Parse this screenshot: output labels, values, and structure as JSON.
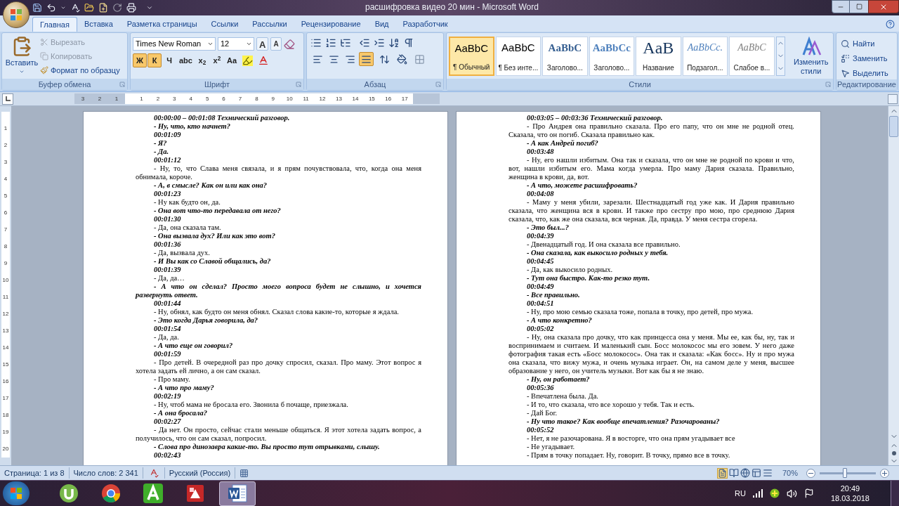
{
  "window": {
    "title": "расшифровка видео 20 мин - Microsoft Word"
  },
  "ribbon_tabs": [
    {
      "label": "Главная",
      "selected": true
    },
    {
      "label": "Вставка",
      "selected": false
    },
    {
      "label": "Разметка страницы",
      "selected": false
    },
    {
      "label": "Ссылки",
      "selected": false
    },
    {
      "label": "Рассылки",
      "selected": false
    },
    {
      "label": "Рецензирование",
      "selected": false
    },
    {
      "label": "Вид",
      "selected": false
    },
    {
      "label": "Разработчик",
      "selected": false
    }
  ],
  "clipboard": {
    "paste": "Вставить",
    "items": [
      {
        "kind": "cut",
        "label": "Вырезать",
        "disabled": true
      },
      {
        "kind": "copy",
        "label": "Копировать",
        "disabled": true
      },
      {
        "kind": "format",
        "label": "Формат по образцу",
        "disabled": false
      }
    ],
    "label": "Буфер обмена"
  },
  "font": {
    "name": "Times New Roman",
    "size": "12",
    "grow": "A",
    "shrink": "A",
    "formats": [
      {
        "label": "Ж",
        "selected": true
      },
      {
        "label": "К",
        "selected": true
      },
      {
        "label": "Ч",
        "selected": false
      },
      {
        "label": "abc",
        "selected": false
      },
      {
        "label": "x$_{2}$",
        "selected": false
      },
      {
        "label": "x$^{2}$",
        "selected": false
      },
      {
        "label": "Aa",
        "selected": false
      }
    ],
    "label": "Шрифт"
  },
  "paragraph": {
    "alignments": [
      {
        "kind": "left",
        "selected": false
      },
      {
        "kind": "center",
        "selected": false
      },
      {
        "kind": "right",
        "selected": false
      },
      {
        "kind": "justify",
        "selected": true
      }
    ],
    "label": "Абзац"
  },
  "styles": {
    "items": [
      {
        "kind": "normal",
        "sample": "AaBbC",
        "label": "¶ Обычный",
        "selected": true
      },
      {
        "kind": "normal",
        "sample": "AaBbC",
        "label": "¶ Без инте...",
        "selected": false
      },
      {
        "kind": "heading1",
        "sample": "AaBbC",
        "label": "Заголово...",
        "selected": false
      },
      {
        "kind": "heading2",
        "sample": "AaBbCc",
        "label": "Заголово...",
        "selected": false
      },
      {
        "kind": "title",
        "sample": "AaB",
        "label": "Название",
        "selected": false
      },
      {
        "kind": "subtitle",
        "sample": "AaBbCc.",
        "label": "Подзагол...",
        "selected": false
      },
      {
        "kind": "subtle",
        "sample": "AaBbC",
        "label": "Слабое в...",
        "selected": false
      }
    ],
    "change": "Изменить стили",
    "label": "Стили"
  },
  "editing": {
    "items": [
      {
        "kind": "find",
        "label": "Найти"
      },
      {
        "kind": "replace",
        "label": "Заменить"
      },
      {
        "kind": "select",
        "label": "Выделить"
      }
    ],
    "label": "Редактирование"
  },
  "ruler": {
    "left_labels": [
      "3",
      "2",
      "1"
    ],
    "right_labels": [
      "1",
      "2",
      "3",
      "4",
      "5",
      "6",
      "7",
      "8",
      "9",
      "10",
      "11",
      "12",
      "13",
      "14",
      "15",
      "16",
      "17"
    ]
  },
  "vertical_ruler": [
    "1",
    "2",
    "3",
    "4",
    "5",
    "6",
    "7",
    "8",
    "9",
    "10",
    "11",
    "12",
    "13",
    "14",
    "15",
    "16",
    "17",
    "18",
    "19",
    "20"
  ],
  "pages": [
    {
      "paragraphs": [
        {
          "kind": "time",
          "text": "00:00:00 – 00:01:08 Технический разговор."
        },
        {
          "kind": "question",
          "text": "- Ну, что, кто начнет?"
        },
        {
          "kind": "time",
          "text": "00:01:09"
        },
        {
          "kind": "question",
          "text": "- Я?"
        },
        {
          "kind": "question",
          "text": "- Да."
        },
        {
          "kind": "time",
          "text": "00:01:12"
        },
        {
          "kind": "speech",
          "text": "- Ну, то, что Слава меня связала, и я прям почувствовала, что, когда она меня обнимала, короче."
        },
        {
          "kind": "question",
          "text": "- А, в смысле? Как он или как она?"
        },
        {
          "kind": "time",
          "text": "00:01:23"
        },
        {
          "kind": "speech",
          "text": "- Ну как будто он, да."
        },
        {
          "kind": "question",
          "text": "- Она вот что-то передавала от него?"
        },
        {
          "kind": "time",
          "text": "00:01:30"
        },
        {
          "kind": "speech",
          "text": "- Да, она сказала там."
        },
        {
          "kind": "question",
          "text": "- Она вызвала дух? Или как это вот?"
        },
        {
          "kind": "time",
          "text": "00:01:36"
        },
        {
          "kind": "speech",
          "text": "- Да, вызвала дух."
        },
        {
          "kind": "question",
          "text": "- И Вы как со Славой общались, да?"
        },
        {
          "kind": "time",
          "text": "00:01:39"
        },
        {
          "kind": "speech",
          "text": "- Да, да…"
        },
        {
          "kind": "question",
          "text": "- А что он сделал? Просто моего вопроса будет не слышно, и хочется развернуть ответ."
        },
        {
          "kind": "time",
          "text": "00:01:44"
        },
        {
          "kind": "speech",
          "text": "- Ну, обнял, как будто он меня обнял. Сказал слова какие-то, которые я ждала."
        },
        {
          "kind": "question",
          "text": "- Это когда Дарья говорила, да?"
        },
        {
          "kind": "time",
          "text": "00:01:54"
        },
        {
          "kind": "speech",
          "text": "- Да, да."
        },
        {
          "kind": "question",
          "text": "- А что еще он говорил?"
        },
        {
          "kind": "time",
          "text": "00:01:59"
        },
        {
          "kind": "speech",
          "text": "- Про детей. В очередной раз про дочку спросил, сказал. Про маму. Этот вопрос я хотела задать ей лично, а он сам сказал."
        },
        {
          "kind": "speech",
          "text": "- Про маму."
        },
        {
          "kind": "question",
          "text": "- А что про маму?"
        },
        {
          "kind": "time",
          "text": "00:02:19"
        },
        {
          "kind": "speech",
          "text": "- Ну, чтоб мама не бросала его. Звонила б почаще, приезжала."
        },
        {
          "kind": "question",
          "text": "- А она бросала?"
        },
        {
          "kind": "time",
          "text": "00:02:27"
        },
        {
          "kind": "speech",
          "text": "- Да нет. Он просто, сейчас стали меньше общаться. Я этот хотела задать вопрос, а получилось, что он сам сказал, попросил."
        },
        {
          "kind": "question",
          "text": "- Слова про динозавра какие-то. Вы просто тут отрывками, слышу."
        },
        {
          "kind": "time",
          "text": "00:02:43"
        }
      ]
    },
    {
      "paragraphs": [
        {
          "kind": "time",
          "text": "00:03:05 – 00:03:36 Технический разговор."
        },
        {
          "kind": "speech",
          "text": "- Про Андрея она правильно сказала. Про его папу, что он мне не родной отец. Сказала, что он погиб. Сказала правильно как."
        },
        {
          "kind": "question",
          "text": "- А как Андрей погиб?"
        },
        {
          "kind": "time",
          "text": "00:03:48"
        },
        {
          "kind": "speech",
          "text": "- Ну, его нашли избитым. Она так и сказала, что он мне не родной по крови и что, вот, нашли избитым его. Мама когда умерла. Про маму Дария сказала. Правильно, женщина в крови, да, вот."
        },
        {
          "kind": "question",
          "text": "- А что, можете расшифровать?"
        },
        {
          "kind": "time",
          "text": "00:04:08"
        },
        {
          "kind": "speech",
          "text": "- Маму у меня убили, зарезали. Шестнадцатый год уже как. И Дария правильно сказала, что женщина вся в крови. И также про сестру про мою, про среднюю Дария сказала, что, как же она сказала, вся черная. Да, правда. У меня сестра сгорела."
        },
        {
          "kind": "question",
          "text": "- Это был...?"
        },
        {
          "kind": "time",
          "text": "00:04:39"
        },
        {
          "kind": "speech",
          "text": "- Двенадцатый год. И она сказала все правильно."
        },
        {
          "kind": "question",
          "text": "- Она сказала, как выкосило родных у тебя."
        },
        {
          "kind": "time",
          "text": "00:04:45"
        },
        {
          "kind": "speech",
          "text": "- Да, как выкосило родных."
        },
        {
          "kind": "question",
          "text": "- Тут она быстро. Как-то резко тут."
        },
        {
          "kind": "time",
          "text": "00:04:49"
        },
        {
          "kind": "question",
          "text": "- Все правильно."
        },
        {
          "kind": "time",
          "text": "00:04:51"
        },
        {
          "kind": "speech",
          "text": "- Ну, про мою семью сказала тоже, попала в точку, про детей, про мужа."
        },
        {
          "kind": "question",
          "text": "- А что конкретно?"
        },
        {
          "kind": "time",
          "text": "00:05:02"
        },
        {
          "kind": "speech",
          "text": "- Ну, она сказала про дочку, что как принцесса она у меня. Мы ее, как бы, ну, так и воспринимаем и считаем. И маленький сын. Босс молокосос мы его зовем. У него даже фотография такая есть «Босс молокосос». Она так и сказала: «Как босс». Ну и про мужа она сказала, что вижу мужа, и очень музыка играет. Он, на самом деле у меня, высшее образование у него, он учитель музыки. Вот как бы я не знаю."
        },
        {
          "kind": "question",
          "text": "- Ну, он работает?"
        },
        {
          "kind": "time",
          "text": "00:05:36"
        },
        {
          "kind": "speech",
          "text": "- Впечатлена была. Да."
        },
        {
          "kind": "speech",
          "text": "- И то, что сказала, что все хорошо у тебя. Так и есть."
        },
        {
          "kind": "speech",
          "text": "- Дай Бог."
        },
        {
          "kind": "question",
          "text": "- Ну что такое? Как вообще впечатления? Разочарованы?"
        },
        {
          "kind": "time",
          "text": "00:05:52"
        },
        {
          "kind": "speech",
          "text": "- Нет, я не разочарована. Я в восторге, что она прям угадывает все"
        },
        {
          "kind": "speech",
          "text": "- Не угадывает."
        },
        {
          "kind": "speech",
          "text": "- Прям в точку попадает. Ну, говорит. В точку, прямо все в точку."
        }
      ]
    }
  ],
  "status_bar": {
    "page": "Страница: 1 из 8",
    "words": "Число слов: 2 341",
    "language": "Русский (Россия)",
    "zoom": "70%",
    "zoom_slider": {
      "level": 0.45
    }
  },
  "taskbar": {
    "apps": [
      {
        "kind": "utorrent",
        "selected": false
      },
      {
        "kind": "chrome",
        "selected": false
      },
      {
        "kind": "green",
        "selected": false
      },
      {
        "kind": "red",
        "selected": false
      },
      {
        "kind": "word",
        "selected": true
      }
    ],
    "language": "RU",
    "time": "20:49",
    "date": "18.03.2018"
  }
}
